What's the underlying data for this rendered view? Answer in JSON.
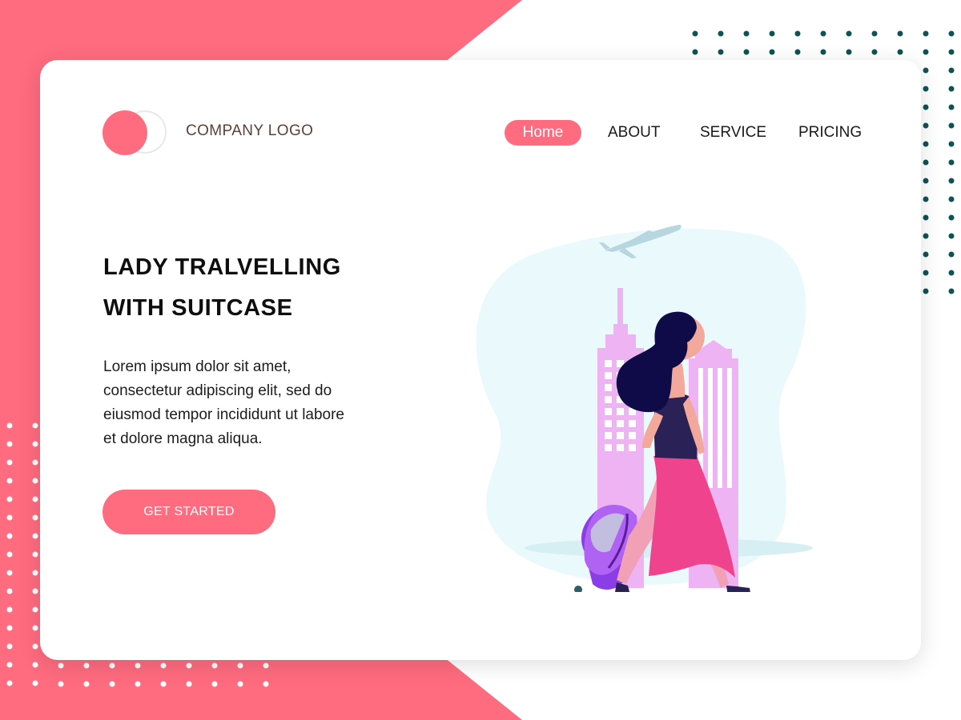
{
  "colors": {
    "accent": "#ff6b7f",
    "teal_dots": "#0f5256",
    "logo_text": "#5a4037"
  },
  "brand": {
    "logo_text": "COMPANY LOGO"
  },
  "nav": {
    "home": "Home",
    "about": "ABOUT",
    "service": "SERVICE",
    "pricing": "PRICING"
  },
  "hero": {
    "title_line1": "LADY TRALVELLING",
    "title_line2": "WITH SUITCASE",
    "description": "Lorem ipsum dolor sit amet, consectetur adipiscing elit, sed do eiusmod tempor incididunt ut labore et dolore magna aliqua.",
    "cta_label": "GET STARTED"
  },
  "illustration": {
    "name": "woman-with-suitcase-illustration"
  }
}
